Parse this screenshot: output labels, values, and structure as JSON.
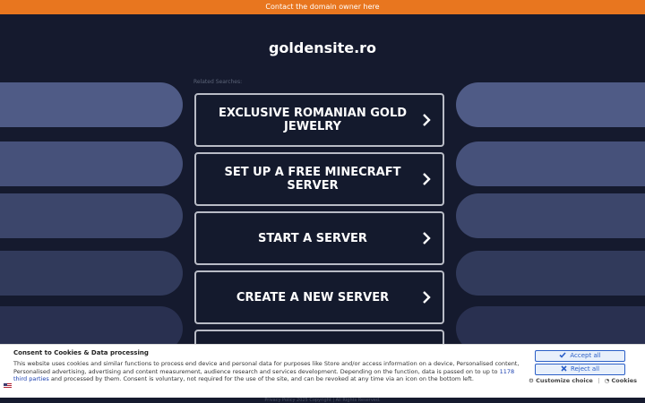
{
  "topbar": {
    "text": "Contact the domain owner here"
  },
  "site": {
    "title": "goldensite.ro",
    "related_label": "Related Searches:"
  },
  "results": [
    {
      "label": "EXCLUSIVE ROMANIAN GOLD JEWELRY"
    },
    {
      "label": "SET UP A FREE MINECRAFT SERVER"
    },
    {
      "label": "START A SERVER"
    },
    {
      "label": "CREATE A NEW SERVER"
    },
    {
      "label": ""
    }
  ],
  "cookie": {
    "title": "Consent to Cookies & Data processing",
    "text_before": "This website uses cookies and similar functions to process end device and personal data for purposes like Store and/or access information on a device, Personalised content, Personalised advertising, advertising and content measurement, audience research and services development. Depending on the function, data is passed on to up to ",
    "link_text": "1178 third parties",
    "text_after": " and processed by them. Consent is voluntary, not required for the use of the site, and can be revoked at any time via an icon on the bottom left.",
    "accept_label": "Accept all",
    "reject_label": "Reject all",
    "customize_label": "Customize choice",
    "separator": "|",
    "cookies_label": "Cookies"
  },
  "footer": {
    "text": "Privacy Policy   2025 Copyright | All Rights Reserved."
  },
  "colors": {
    "accent": "#e8761f",
    "background": "#1a2036",
    "button_blue": "#2b5fc7"
  }
}
